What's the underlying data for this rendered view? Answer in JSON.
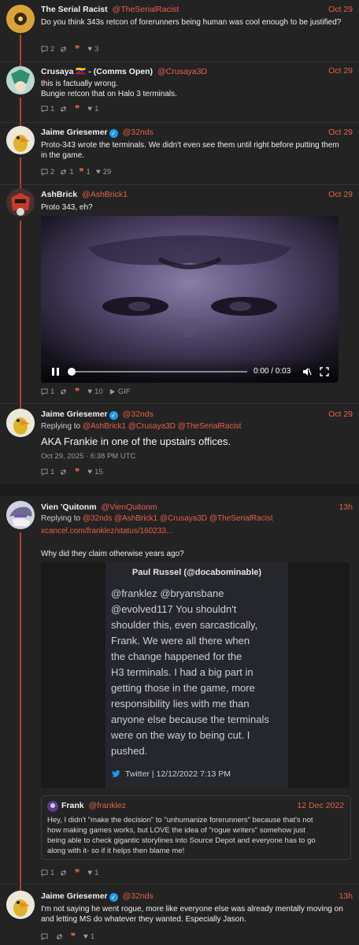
{
  "colors": {
    "accent": "#e8604a",
    "thread": "#b5412a",
    "verified": "#1d9bf0",
    "bg": "#232323"
  },
  "tweets": [
    {
      "name": "The Serial Racist",
      "handle": "@TheSerialRacist",
      "date": "Oct 29",
      "text": "Do you think 343s retcon of forerunners being human was cool enough to be justified?",
      "replies": "2",
      "retweets": "",
      "quotes": "",
      "likes": "3"
    },
    {
      "name": "Crusaya 🇻🇪 - (Comms Open)",
      "handle": "@Crusaya3D",
      "date": "Oct 29",
      "text_line1": "this is factually wrong.",
      "text_line2": "Bungie retcon that on Halo 3 terminals.",
      "replies": "1",
      "retweets": "",
      "quotes": "",
      "likes": "1"
    },
    {
      "name": "Jaime Griesemer",
      "handle": "@32nds",
      "date": "Oct 29",
      "text": "Proto-343 wrote the terminals. We didn't even see them until right before putting them in the game.",
      "replies": "2",
      "retweets": "1",
      "quotes": "1",
      "likes": "29"
    },
    {
      "name": "AshBrick",
      "handle": "@AshBrick1",
      "date": "Oct 29",
      "text": "Proto 343, eh?",
      "video_time": "0:00 / 0:03",
      "replies": "1",
      "retweets": "",
      "quotes": "",
      "likes": "10",
      "gif_label": "GIF"
    },
    {
      "name": "Jaime Griesemer",
      "handle": "@32nds",
      "date": "Oct 29",
      "replying_label": "Replying to",
      "replying_handles": "@AshBrick1 @Crusaya3D @TheSerialRacist",
      "text": "AKA Frankie in one of the upstairs offices.",
      "timestamp": "Oct 29, 2025 · 6:38 PM UTC",
      "replies": "1",
      "retweets": "",
      "quotes": "",
      "likes": "15"
    },
    {
      "name": "Vien 'Quitonm",
      "handle": "@VienQuitonm",
      "date": "13h",
      "replying_label": "Replying to",
      "replying_handles": "@32nds @AshBrick1 @Crusaya3D @TheSerialRacist",
      "link": "xcancel.com/franklez/status/160233...",
      "text": "Why did they claim otherwise years ago?",
      "replies": "1",
      "retweets": "",
      "quotes": "",
      "likes": "1"
    },
    {
      "name": "Jaime Griesemer",
      "handle": "@32nds",
      "date": "13h",
      "text": "I'm not saying he went rogue, more like everyone else was already mentally moving on and letting MS do whatever they wanted. Especially Jason.",
      "replies": "",
      "retweets": "",
      "quotes": "",
      "likes": "1"
    }
  ],
  "screenshot": {
    "header": "Paul Russel (@docabominable)",
    "lines": [
      "@franklez @bryansbane",
      "@evolved117 You shouldn't",
      "shoulder this, even sarcastically,",
      "Frank. We were all there when",
      "the change happened for the",
      "H3 terminals. I had a big part in",
      "getting those in the game, more",
      "responsibility lies with me than",
      "anyone else because the terminals",
      "were on the way to being cut. I",
      "pushed."
    ],
    "footer": "Twitter | 12/12/2022 7:13 PM"
  },
  "quoted": {
    "name": "Frank",
    "handle": "@franklez",
    "date": "12 Dec 2022",
    "lines": [
      "Hey, I didn't \"make the decision\" to \"unhumanize forerunners\" because that's not",
      "how making games works, but LOVE the idea of \"rogue writers\" somehow just",
      "being able to check gigantic storylines into Source Depot and everyone has to go",
      "along with it- so if it helps then blame me!"
    ]
  }
}
